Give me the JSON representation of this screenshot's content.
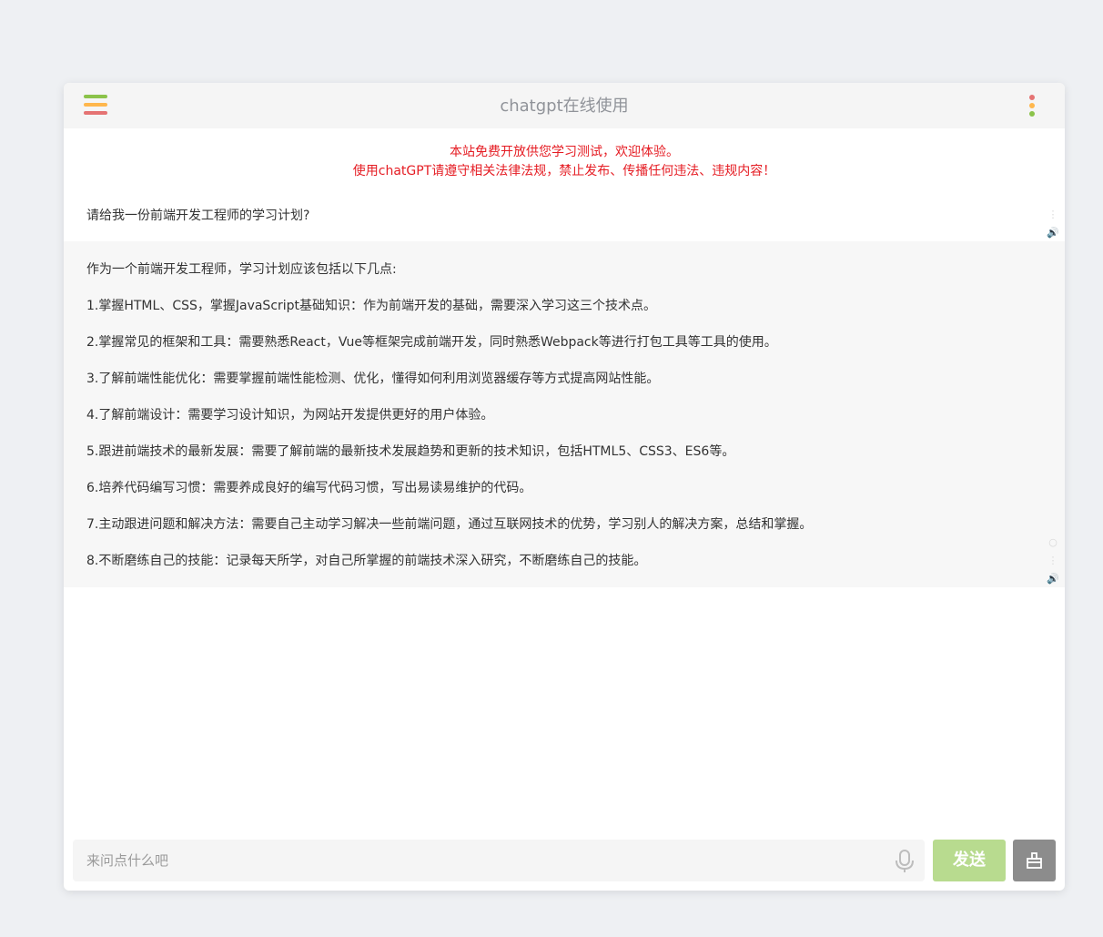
{
  "header": {
    "title": "chatgpt在线使用",
    "menu_colors": [
      "#8bc34a",
      "#ffb74d",
      "#e57373"
    ],
    "more_colors": [
      "#e57373",
      "#ffb74d",
      "#8bc34a"
    ]
  },
  "notice": {
    "line1": "本站免费开放供您学习测试，欢迎体验。",
    "line2": "使用chatGPT请遵守相关法律法规，禁止发布、传播任何违法、违规内容！"
  },
  "messages": {
    "user": {
      "text": "请给我一份前端开发工程师的学习计划?"
    },
    "bot": {
      "paragraphs": [
        "作为一个前端开发工程师，学习计划应该包括以下几点:",
        "1.掌握HTML、CSS，掌握JavaScript基础知识：作为前端开发的基础，需要深入学习这三个技术点。",
        "2.掌握常见的框架和工具：需要熟悉React，Vue等框架完成前端开发，同时熟悉Webpack等进行打包工具等工具的使用。",
        "3.了解前端性能优化：需要掌握前端性能检测、优化，懂得如何利用浏览器缓存等方式提高网站性能。",
        "4.了解前端设计：需要学习设计知识，为网站开发提供更好的用户体验。",
        "5.跟进前端技术的最新发展：需要了解前端的最新技术发展趋势和更新的技术知识，包括HTML5、CSS3、ES6等。",
        "6.培养代码编写习惯：需要养成良好的编写代码习惯，写出易读易维护的代码。",
        "7.主动跟进问题和解决方法：需要自己主动学习解决一些前端问题，通过互联网技术的优势，学习别人的解决方案，总结和掌握。",
        "8.不断磨练自己的技能：记录每天所学，对自己所掌握的前端技术深入研究，不断磨练自己的技能。"
      ]
    }
  },
  "input": {
    "placeholder": "来问点什么吧",
    "value": ""
  },
  "actions": {
    "send_label": "发送"
  },
  "colors": {
    "notice": "#e51c23",
    "send_button": "#b8db8f",
    "clear_button": "#8c8c8c"
  }
}
